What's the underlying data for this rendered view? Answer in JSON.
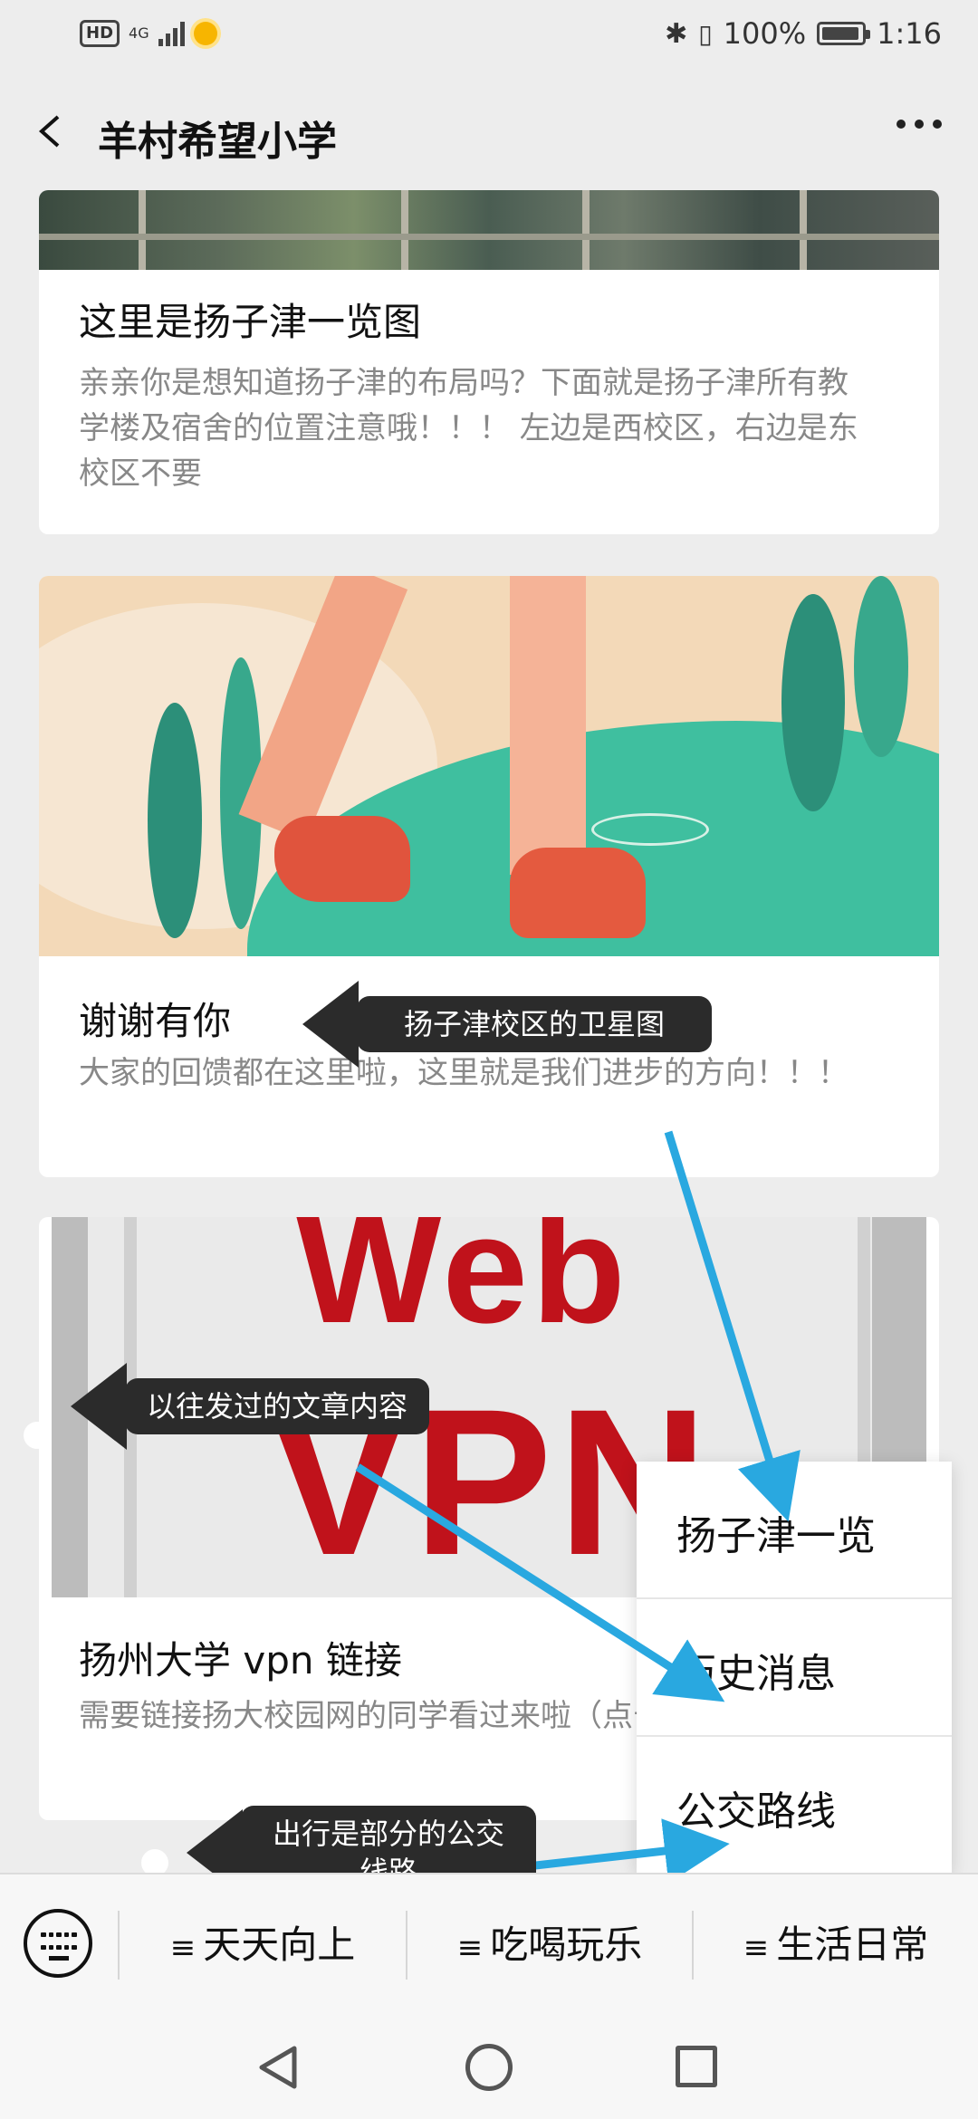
{
  "status_bar": {
    "hd": "HD",
    "network": "4G",
    "battery_percent": "100%",
    "time": "1:16",
    "battery_level": 0.95
  },
  "header": {
    "title": "羊村希望小学",
    "back_icon": "back-chevron-icon",
    "more_icon": "more-dots-icon"
  },
  "articles": [
    {
      "title": "这里是扬子津一览图",
      "description": "亲亲你是想知道扬子津的布局吗？下面就是扬子津所有教学楼及宿舍的位置注意哦！！！ 左边是西校区，右边是东校区不要"
    },
    {
      "title": "谢谢有你",
      "description": "大家的回馈都在这里啦，这里就是我们进步的方向！！！"
    },
    {
      "title": "扬州大学 vpn 链接",
      "description": "需要链接扬大校园网的同学看过来啦（点击阅读原文进入）",
      "image_text_1": "Web",
      "image_text_2": "VPN"
    }
  ],
  "popup_menu": {
    "items": [
      "扬子津一览",
      "历史消息",
      "公交路线"
    ]
  },
  "annotations": [
    {
      "text": "扬子津校区的卫星图"
    },
    {
      "text": "以往发过的文章内容"
    },
    {
      "text": "出行是部分的公交线路"
    }
  ],
  "menu_bar": {
    "keyboard_icon": "keyboard-icon",
    "tabs": [
      {
        "icon": "≡",
        "label": "天天向上"
      },
      {
        "icon": "≡",
        "label": "吃喝玩乐"
      },
      {
        "icon": "≡",
        "label": "生活日常"
      }
    ]
  },
  "nav_bar": {
    "icons": [
      "nav-back-icon",
      "nav-home-icon",
      "nav-recents-icon"
    ]
  },
  "colors": {
    "background": "#ededed",
    "card": "#ffffff",
    "tooltip": "#2b2b2b",
    "arrow": "#29a8e0",
    "vpn_red": "#c0121b"
  }
}
